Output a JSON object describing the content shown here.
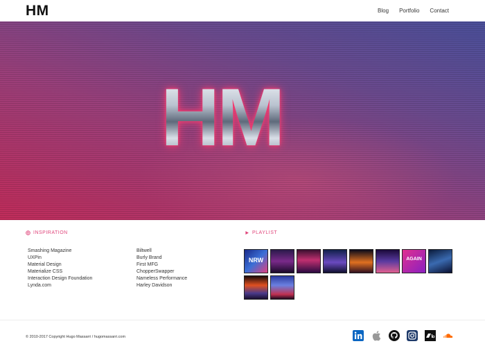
{
  "header": {
    "logo": "HM",
    "nav": [
      "Blog",
      "Portfolio",
      "Contact"
    ]
  },
  "hero": {
    "logo_text": "HM"
  },
  "inspiration": {
    "title": "INSPIRATION",
    "icon": "globe-icon",
    "column1": [
      "Smashing Magazine",
      "UXPin",
      "Material Design",
      "Materialize CSS",
      "Interaction Design Foundation",
      "Lynda.com"
    ],
    "column2": [
      "Biltwell",
      "Burly Brand",
      "First MFG",
      "ChopperSwapper",
      "Nameless Performance",
      "Harley Davidson"
    ]
  },
  "playlist": {
    "title": "PLAYLIST",
    "icon": "play-icon",
    "albums": [
      {
        "name": "album-nrw-records",
        "text": "NRW"
      },
      {
        "name": "album-2",
        "text": ""
      },
      {
        "name": "album-3",
        "text": ""
      },
      {
        "name": "album-4",
        "text": ""
      },
      {
        "name": "album-5",
        "text": ""
      },
      {
        "name": "album-6",
        "text": ""
      },
      {
        "name": "album-again",
        "text": "AGAIN"
      },
      {
        "name": "album-8",
        "text": ""
      },
      {
        "name": "album-9",
        "text": ""
      },
      {
        "name": "album-10",
        "text": ""
      }
    ]
  },
  "footer": {
    "copyright": "© 2010-2017 Copyright Hugo Massarri / hugomassarri.com",
    "social": [
      "linkedin-icon",
      "apple-icon",
      "github-icon",
      "instagram-icon",
      "bandcamp-icon",
      "soundcloud-icon"
    ]
  },
  "colors": {
    "accent": "#e0457b",
    "linkedin": "#0a66c2",
    "soundcloud": "#ff6a00"
  }
}
